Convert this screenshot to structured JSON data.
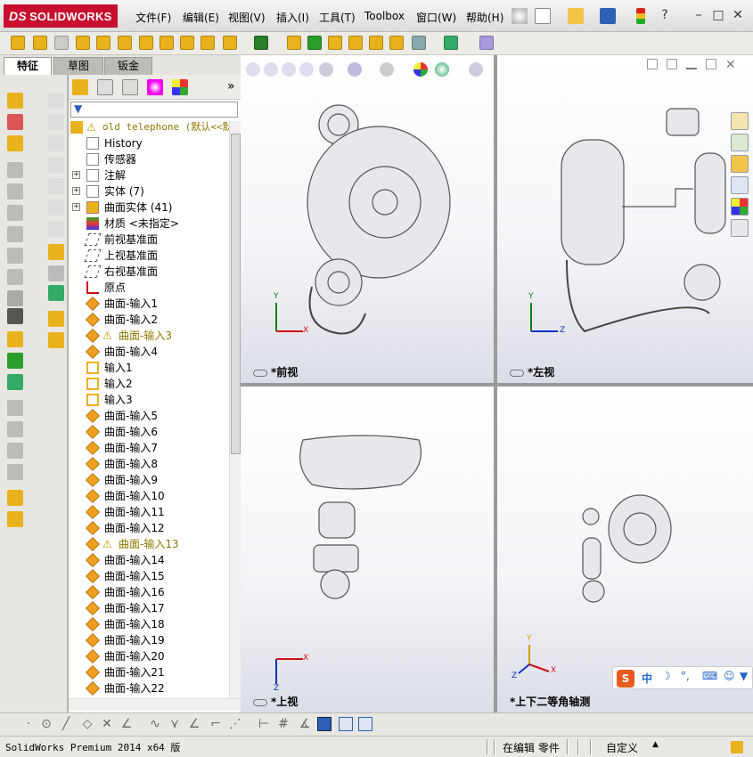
{
  "app": {
    "logo_text": "SOLIDWORKS",
    "logo_prefix": "DS"
  },
  "menu": [
    "文件(F)",
    "编辑(E)",
    "视图(V)",
    "插入(I)",
    "工具(T)",
    "Toolbox",
    "窗口(W)",
    "帮助(H)"
  ],
  "tabs": [
    "特征",
    "草图",
    "钣金"
  ],
  "tree": {
    "root": "old telephone (默认<<默",
    "nodes": [
      {
        "label": "History",
        "icon": "history-icon"
      },
      {
        "label": "传感器",
        "icon": "sensor-icon"
      },
      {
        "label": "注解",
        "icon": "annotation-icon",
        "expand": true
      },
      {
        "label": "实体 (7)",
        "icon": "solid-body-icon",
        "expand": true
      },
      {
        "label": "曲面实体 (41)",
        "icon": "surface-body-icon",
        "expand": true
      },
      {
        "label": "材质 <未指定>",
        "icon": "material-icon"
      },
      {
        "label": "前视基准面",
        "icon": "plane-icon"
      },
      {
        "label": "上视基准面",
        "icon": "plane-icon"
      },
      {
        "label": "右视基准面",
        "icon": "plane-icon"
      },
      {
        "label": "原点",
        "icon": "origin-icon"
      },
      {
        "label": "曲面-输入1",
        "icon": "surface-import-icon"
      },
      {
        "label": "曲面-输入2",
        "icon": "surface-import-icon"
      },
      {
        "label": "曲面-输入3",
        "icon": "surface-import-icon",
        "warn": true
      },
      {
        "label": "曲面-输入4",
        "icon": "surface-import-icon"
      },
      {
        "label": "输入1",
        "icon": "import-icon"
      },
      {
        "label": "输入2",
        "icon": "import-icon"
      },
      {
        "label": "输入3",
        "icon": "import-icon"
      },
      {
        "label": "曲面-输入5",
        "icon": "surface-import-icon"
      },
      {
        "label": "曲面-输入6",
        "icon": "surface-import-icon"
      },
      {
        "label": "曲面-输入7",
        "icon": "surface-import-icon"
      },
      {
        "label": "曲面-输入8",
        "icon": "surface-import-icon"
      },
      {
        "label": "曲面-输入9",
        "icon": "surface-import-icon"
      },
      {
        "label": "曲面-输入10",
        "icon": "surface-import-icon"
      },
      {
        "label": "曲面-输入11",
        "icon": "surface-import-icon"
      },
      {
        "label": "曲面-输入12",
        "icon": "surface-import-icon"
      },
      {
        "label": "曲面-输入13",
        "icon": "surface-import-icon",
        "warn": true
      },
      {
        "label": "曲面-输入14",
        "icon": "surface-import-icon"
      },
      {
        "label": "曲面-输入15",
        "icon": "surface-import-icon"
      },
      {
        "label": "曲面-输入16",
        "icon": "surface-import-icon"
      },
      {
        "label": "曲面-输入17",
        "icon": "surface-import-icon"
      },
      {
        "label": "曲面-输入18",
        "icon": "surface-import-icon"
      },
      {
        "label": "曲面-输入19",
        "icon": "surface-import-icon"
      },
      {
        "label": "曲面-输入20",
        "icon": "surface-import-icon"
      },
      {
        "label": "曲面-输入21",
        "icon": "surface-import-icon"
      },
      {
        "label": "曲面-输入22",
        "icon": "surface-import-icon"
      }
    ]
  },
  "viewports": [
    {
      "label": "*前视",
      "axes": [
        "Y",
        "X"
      ]
    },
    {
      "label": "*左视",
      "axes": [
        "Y",
        "Z"
      ]
    },
    {
      "label": "*上视",
      "axes": [
        "X",
        "Z"
      ]
    },
    {
      "label": "*上下二等角轴测",
      "axes": [
        "Y",
        "X",
        "Z"
      ]
    }
  ],
  "status": {
    "version": "SolidWorks Premium 2014 x64 版",
    "mode": "在编辑 零件",
    "units": "自定义"
  },
  "ime": {
    "label": "中"
  },
  "colors": {
    "brand": "#c8102e",
    "warn": "#8c7a00",
    "axis_x": "#d01010",
    "axis_y": "#108010",
    "axis_z": "#1030c0"
  }
}
